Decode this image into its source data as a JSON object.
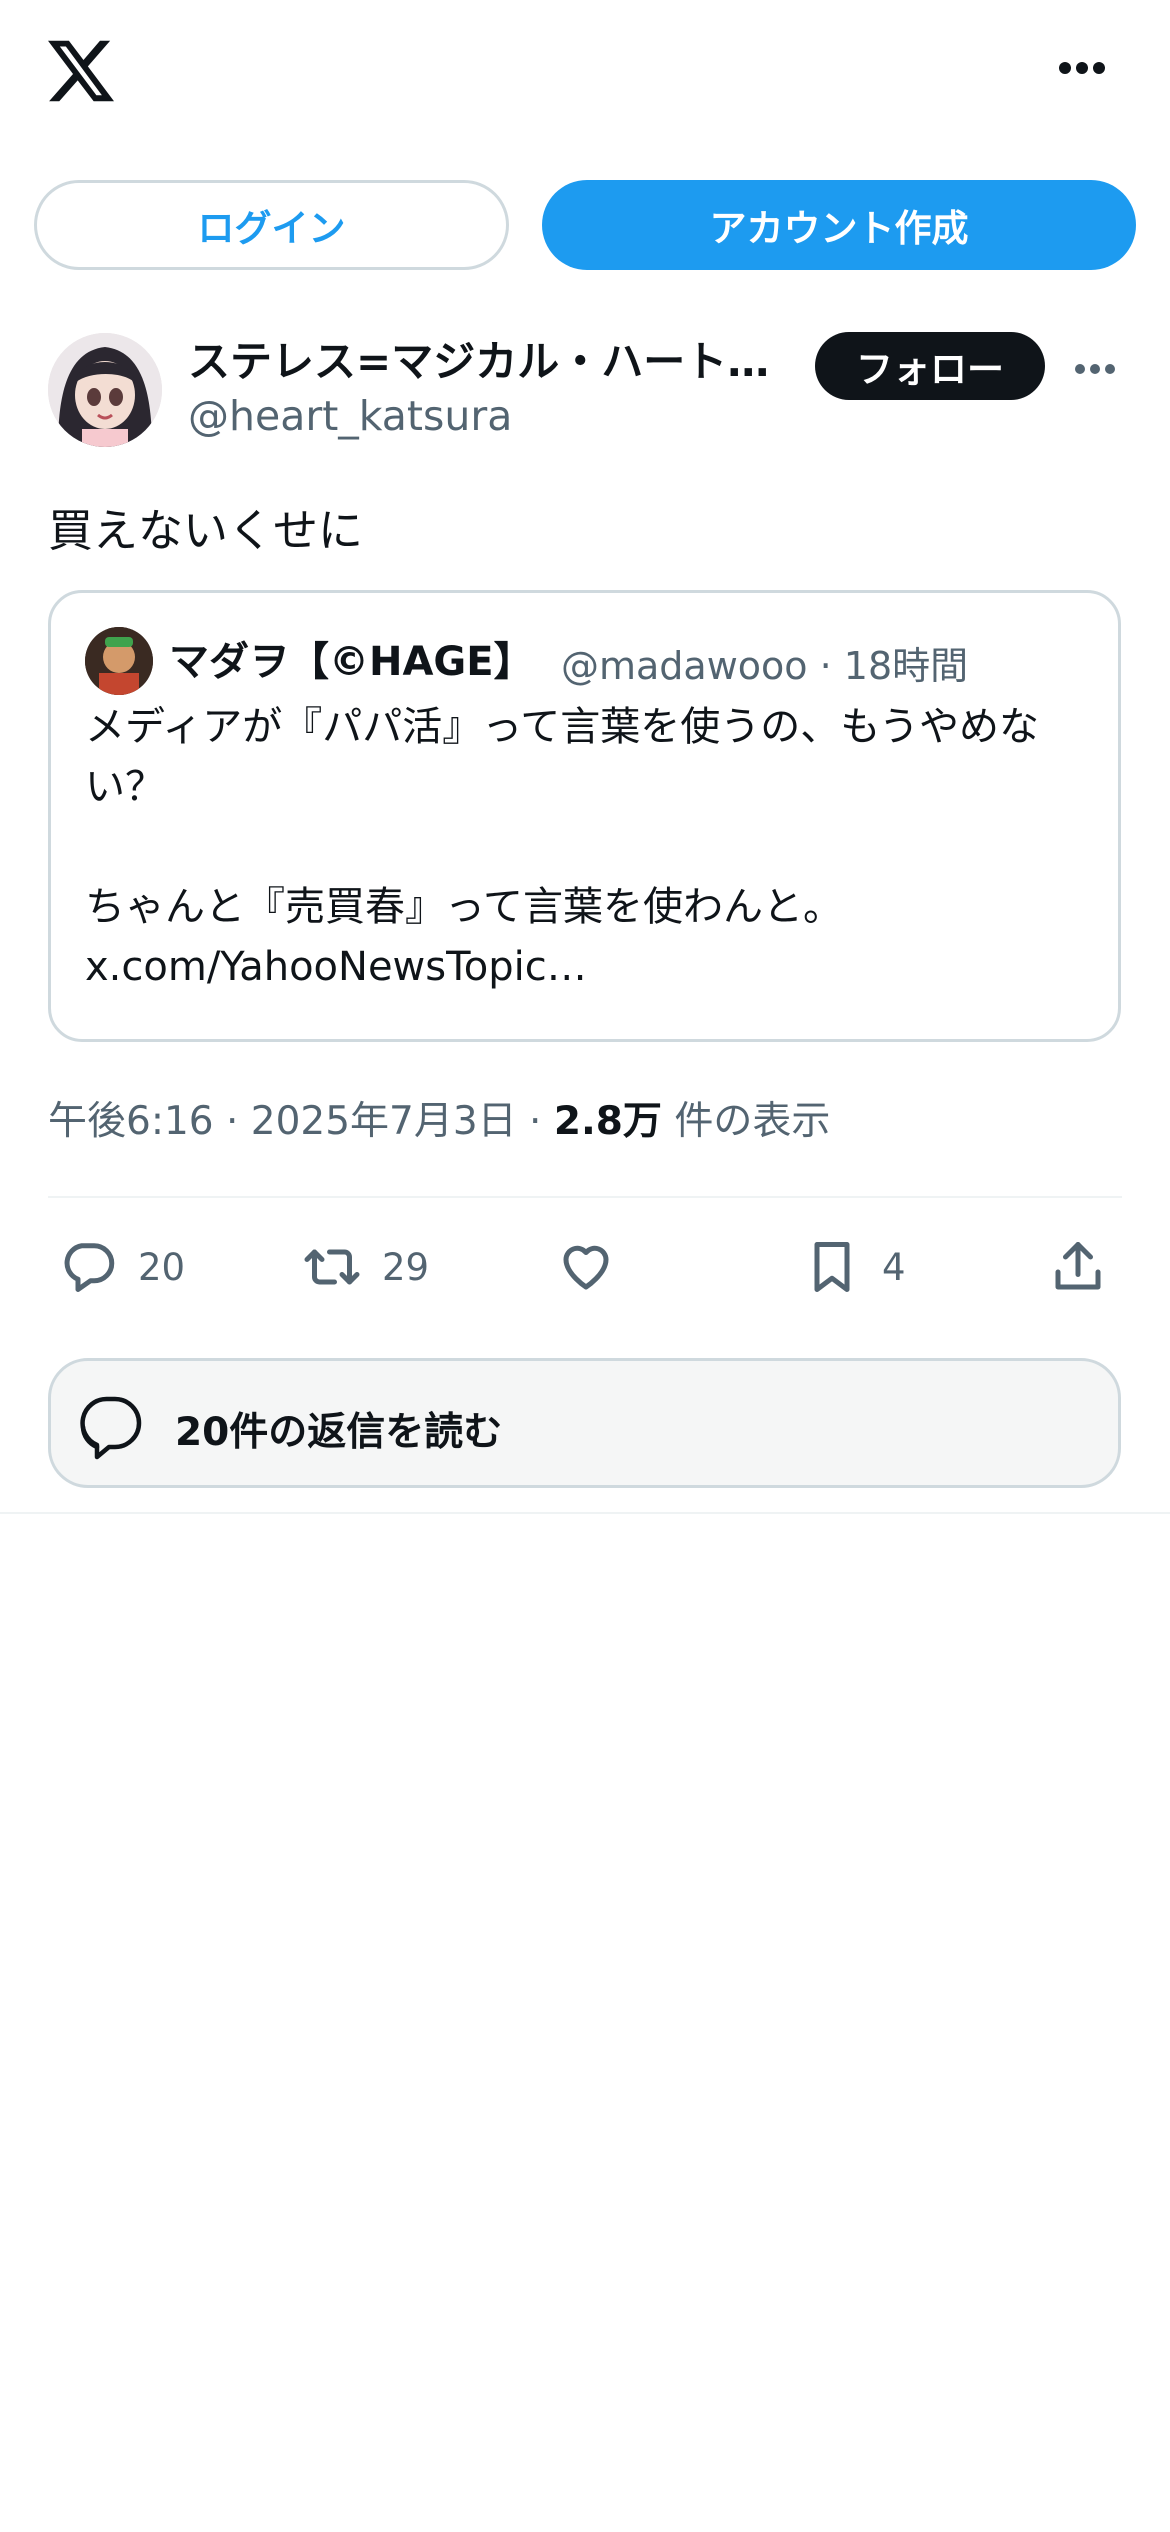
{
  "header": {
    "logo_icon": "x-logo-icon",
    "more_icon": "more-horizontal-icon"
  },
  "auth": {
    "login_label": "ログイン",
    "signup_label": "アカウント作成"
  },
  "post": {
    "author_name": "ステレス=マジカル・ハート…",
    "author_handle": "@heart_katsura",
    "follow_label": "フォロー",
    "text": "買えないくせに",
    "quoted": {
      "name": "マダヲ【©HAGE】",
      "handle_time": "@madawooo · 18時間",
      "text": "メディアが『パパ活』って言葉を使うの、もうやめない？\n\nちゃんと『売買春』って言葉を使わんと。\nx.com/YahooNewsTopic…"
    },
    "time": "午後6:16 · 2025年7月3日 · ",
    "views_count": "2.8万",
    "views_label": " 件の表示"
  },
  "actions": {
    "reply_count": "20",
    "retweet_count": "29",
    "like_count": "",
    "bookmark_count": "4"
  },
  "read_replies_label": "20件の返信を読む",
  "colors": {
    "accent": "#1d9bf0",
    "text": "#0f1419",
    "secondary": "#536471",
    "border": "#cfd9de"
  }
}
